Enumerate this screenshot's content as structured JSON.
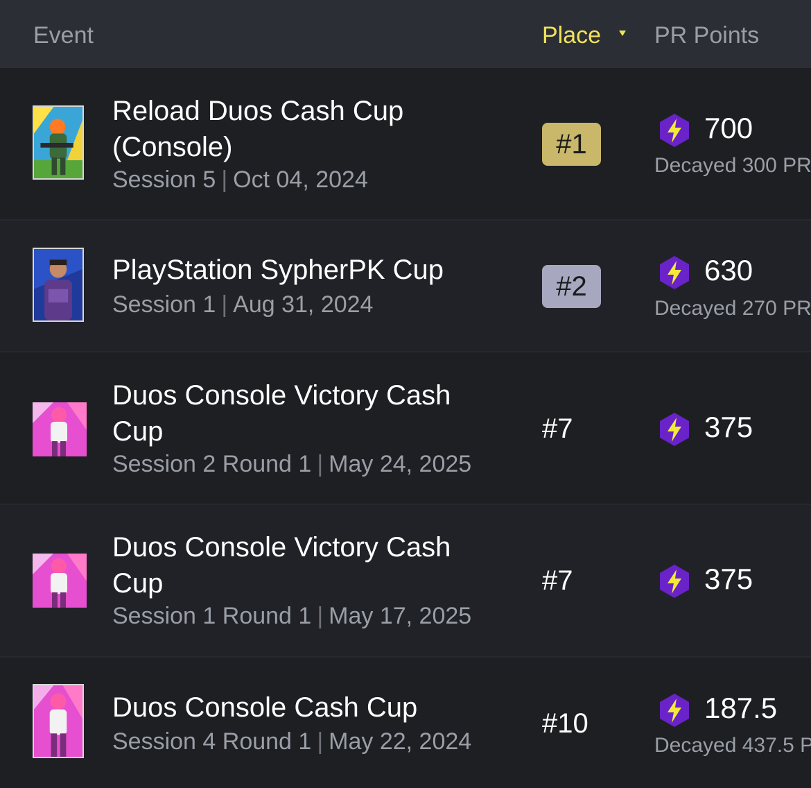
{
  "header": {
    "event_label": "Event",
    "place_label": "Place",
    "pr_label": "PR Points"
  },
  "colors": {
    "accent_yellow": "#f0e35a",
    "gold_badge": "#c9b76a",
    "silver_badge": "#a7a8c0",
    "bolt_purple": "#6a22c9"
  },
  "rows": [
    {
      "title": "Reload Duos Cash Cup (Console)",
      "session": "Session 5",
      "date": "Oct 04, 2024",
      "place": "#1",
      "points": "700",
      "decayed": "Decayed 300 PR"
    },
    {
      "title": "PlayStation SypherPK Cup",
      "session": "Session 1",
      "date": "Aug 31, 2024",
      "place": "#2",
      "points": "630",
      "decayed": "Decayed 270 PR"
    },
    {
      "title": "Duos Console Victory Cash Cup",
      "session": "Session 2 Round 1",
      "date": "May 24, 2025",
      "place": "#7",
      "points": "375"
    },
    {
      "title": "Duos Console Victory Cash Cup",
      "session": "Session 1 Round 1",
      "date": "May 17, 2025",
      "place": "#7",
      "points": "375"
    },
    {
      "title": "Duos Console Cash Cup",
      "session": "Session 4 Round 1",
      "date": "May 22, 2024",
      "place": "#10",
      "points": "187.5",
      "decayed": "Decayed 437.5 P"
    }
  ]
}
